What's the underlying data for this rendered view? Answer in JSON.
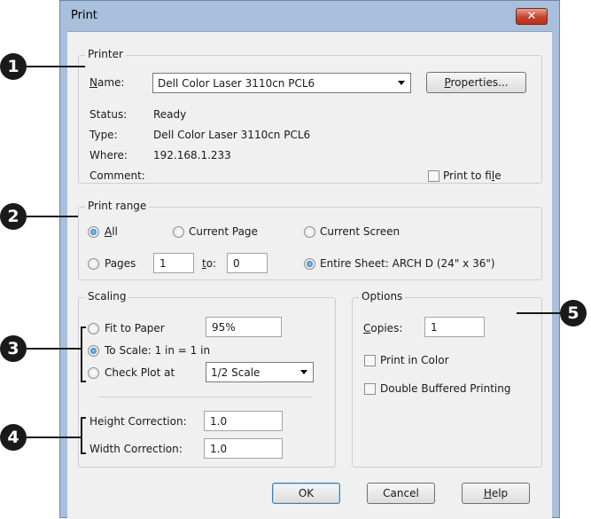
{
  "window": {
    "title": "Print",
    "close_glyph": "✕"
  },
  "printer": {
    "group_title": "Printer",
    "name_label_u": "N",
    "name_label_rest": "ame:",
    "name_value": "Dell Color Laser 3110cn PCL6",
    "properties_u": "P",
    "properties_rest": "roperties...",
    "status_label": "Status:",
    "status_value": "Ready",
    "type_label": "Type:",
    "type_value": "Dell Color Laser 3110cn PCL6",
    "where_label": "Where:",
    "where_value": "192.168.1.233",
    "comment_label": "Comment:",
    "print_to_file_pre": "Print to fi",
    "print_to_file_u": "l",
    "print_to_file_post": "e",
    "print_to_file_checked": false
  },
  "print_range": {
    "group_title": "Print range",
    "all_u": "A",
    "all_rest": "ll",
    "current_page": "Current Page",
    "current_screen": "Current Screen",
    "pages": "Pages",
    "from_value": "1",
    "to_u": "t",
    "to_rest": "o:",
    "to_value": "0",
    "entire_sheet": "Entire Sheet: ARCH D  (24\" x 36\")",
    "selected": "all+entire_sheet"
  },
  "scaling": {
    "group_title": "Scaling",
    "fit_to_paper": "Fit to Paper",
    "fit_value": "95%",
    "to_scale": "To Scale: 1 in = 1 in",
    "check_plot": "Check Plot at",
    "check_plot_value": "1/2 Scale",
    "height_correction": "Height Correction:",
    "height_value": "1.0",
    "width_correction": "Width Correction:",
    "width_value": "1.0"
  },
  "options": {
    "group_title": "Options",
    "copies_u": "C",
    "copies_rest": "opies:",
    "copies_value": "1",
    "print_in_color": "Print in Color",
    "print_in_color_checked": false,
    "double_buffered": "Double Buffered Printing",
    "double_buffered_checked": false
  },
  "buttons": {
    "ok": "OK",
    "cancel": "Cancel",
    "help_u": "H",
    "help_rest": "elp"
  },
  "callouts": [
    "1",
    "2",
    "3",
    "4",
    "5"
  ],
  "colors": {
    "callout": "#1a1a1a",
    "frame": "#a9c0dc",
    "client": "#f0f0f0",
    "close": "#c7432e"
  }
}
